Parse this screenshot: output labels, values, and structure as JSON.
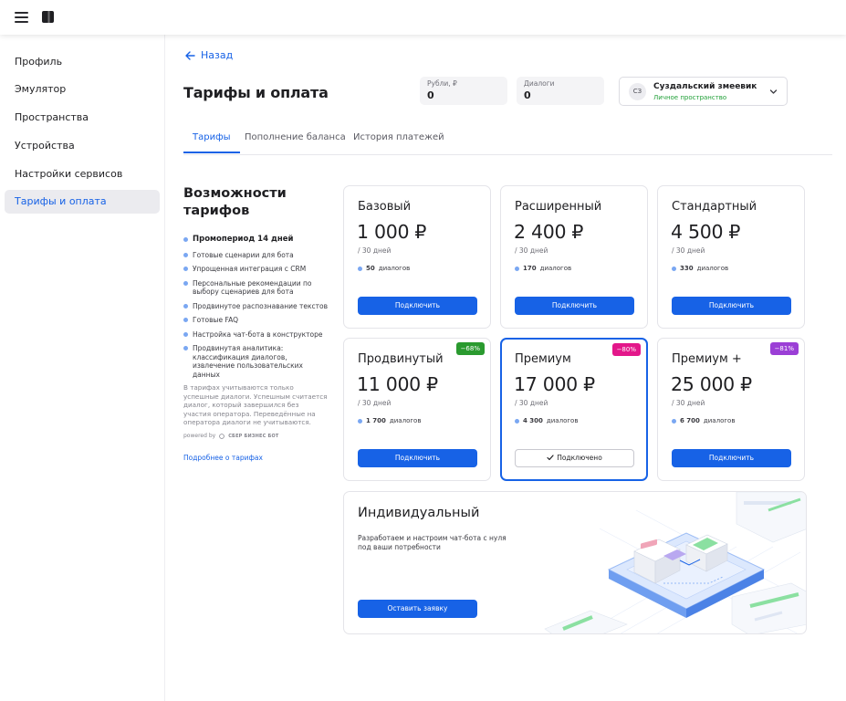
{
  "header": {
    "menu_icon": "menu-icon",
    "logo_icon": "app-logo"
  },
  "sidebar": {
    "items": [
      {
        "label": "Профиль"
      },
      {
        "label": "Эмулятор"
      },
      {
        "label": "Пространства"
      },
      {
        "label": "Устройства"
      },
      {
        "label": "Настройки сервисов"
      },
      {
        "label": "Тарифы и оплата",
        "active": true
      }
    ]
  },
  "page": {
    "back_label": "Назад",
    "title": "Тарифы и оплата",
    "counters": [
      {
        "label": "Рубли, ₽",
        "value": "0"
      },
      {
        "label": "Диалоги",
        "value": "0"
      }
    ],
    "account": {
      "initials": "СЗ",
      "name": "Суздальский змеевик",
      "subtitle": "Личное пространство",
      "subtitle_color": "#21a038"
    },
    "tabs": [
      {
        "label": "Тарифы",
        "active": true
      },
      {
        "label": "Пополнение баланса"
      },
      {
        "label": "История платежей"
      }
    ]
  },
  "features": {
    "title": "Возможности тарифов",
    "items": [
      "Промопериод 14 дней",
      "Готовые сценарии для бота",
      "Упрощенная интеграция с CRM",
      "Персональные рекомендации по выбору сценариев для бота",
      "Продвинутое распознавание текстов",
      "Готовые FAQ",
      "Настройка чат-бота в конструкторе",
      "Продвинутая аналитика: классификация диалогов, извлечение пользовательских данных"
    ],
    "note": "В тарифах учитываются только успешные диалоги. Успешным считается диалог, который завершился без участия оператора. Переведённые на оператора диалоги не учитываются.",
    "powered_by": "powered by",
    "powered_brand": "СБЕР БИЗНЕС БОТ",
    "more_link": "Подробнее о тарифах"
  },
  "plans": [
    {
      "name": "Базовый",
      "price": "1 000 ₽",
      "period": "/ 30 дней",
      "dialogs_count": "50",
      "dialogs_label": "диалогов",
      "button": "Подключить"
    },
    {
      "name": "Расширенный",
      "price": "2 400 ₽",
      "period": "/ 30 дней",
      "dialogs_count": "170",
      "dialogs_label": "диалогов",
      "button": "Подключить"
    },
    {
      "name": "Стандартный",
      "price": "4 500 ₽",
      "period": "/ 30 дней",
      "dialogs_count": "330",
      "dialogs_label": "диалогов",
      "button": "Подключить"
    },
    {
      "name": "Продвинутый",
      "price": "11 000 ₽",
      "period": "/ 30 дней",
      "dialogs_count": "1 700",
      "dialogs_label": "диалогов",
      "button": "Подключить",
      "discount": "−68%",
      "discount_color": "#2a9a2f"
    },
    {
      "name": "Премиум",
      "price": "17 000 ₽",
      "period": "/ 30 дней",
      "dialogs_count": "4 300",
      "dialogs_label": "диалогов",
      "button": "Подключено",
      "connected": true,
      "discount": "−80%",
      "discount_color": "#e3178a"
    },
    {
      "name": "Премиум +",
      "price": "25 000 ₽",
      "period": "/ 30 дней",
      "dialogs_count": "6 700",
      "dialogs_label": "диалогов",
      "button": "Подключить",
      "discount": "−81%",
      "discount_color": "#9b3fd6"
    }
  ],
  "individual": {
    "name": "Индивидуальный",
    "description": "Разработаем и настроим чат-бота с нуля под ваши потребности",
    "button": "Оставить заявку"
  },
  "colors": {
    "accent": "#1762e6",
    "selected_border": "#1762e6"
  }
}
